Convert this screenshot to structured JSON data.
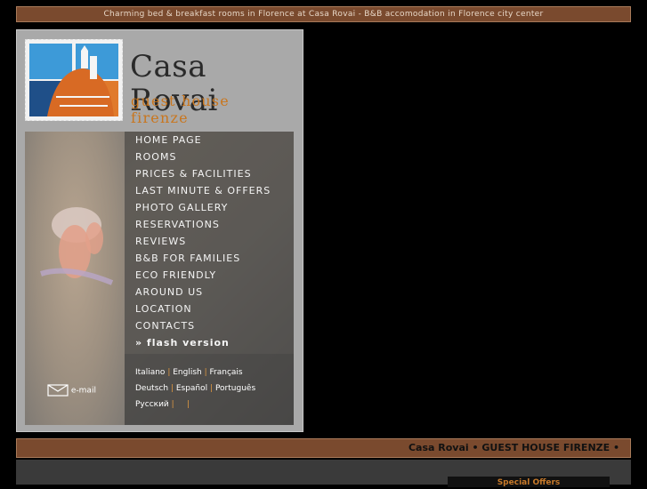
{
  "top_banner": "Charming bed & breakfast rooms in Florence at Casa Rovai - B&B accomodation in Florence city center",
  "logo": {
    "brand": "Casa Rovai",
    "tagline": "guest house firenze"
  },
  "menu": [
    {
      "label": "HOME PAGE"
    },
    {
      "label": "ROOMS"
    },
    {
      "label": "PRICES & FACILITIES"
    },
    {
      "label": "LAST MINUTE & OFFERS"
    },
    {
      "label": "PHOTO GALLERY"
    },
    {
      "label": "RESERVATIONS"
    },
    {
      "label": "REVIEWS"
    },
    {
      "label": "B&B FOR FAMILIES"
    },
    {
      "label": "ECO FRIENDLY"
    },
    {
      "label": "AROUND US"
    },
    {
      "label": "LOCATION"
    },
    {
      "label": "CONTACTS"
    },
    {
      "label": "» flash version"
    }
  ],
  "languages": {
    "row1": [
      "Italiano",
      "English",
      "Français"
    ],
    "row2": [
      "Deutsch",
      "Español",
      "Português"
    ],
    "row3": [
      "Русский"
    ]
  },
  "email_label": "e-mail",
  "bottom_banner": "Casa Rovai • GUEST HOUSE FIRENZE •",
  "special_offers": "Special Offers",
  "colors": {
    "banner": "#7a4a2e",
    "accent": "#c9761e",
    "panel": "#a9a9a9"
  }
}
